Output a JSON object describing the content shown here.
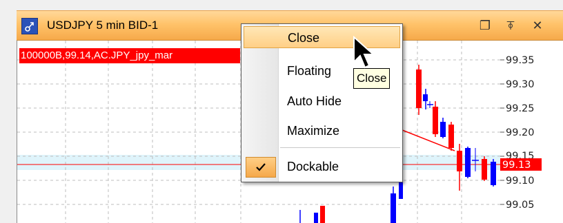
{
  "window": {
    "title": "USDJPY 5 min BID-1",
    "controls": {
      "restore": "❐",
      "pin": "⍕",
      "close": "✕"
    }
  },
  "chart": {
    "symbol_strip": "100000B,99.14,AC.JPY_jpy_mar",
    "price_ticks": [
      "99.35",
      "99.30",
      "99.25",
      "99.20",
      "99.15",
      "99.10",
      "99.05"
    ],
    "current_price": "99.13",
    "colors": {
      "up": "#ff0000",
      "down": "#0000ff",
      "current_line": "#ff0000",
      "band": "#dff4fb"
    }
  },
  "context_menu": {
    "items": [
      {
        "label": "Close",
        "highlight": true
      },
      {
        "label": "Floating"
      },
      {
        "label": "Auto Hide"
      },
      {
        "label": "Maximize"
      },
      {
        "label": "Dockable",
        "checked": true
      }
    ]
  },
  "tooltip": {
    "text": "Close"
  }
}
